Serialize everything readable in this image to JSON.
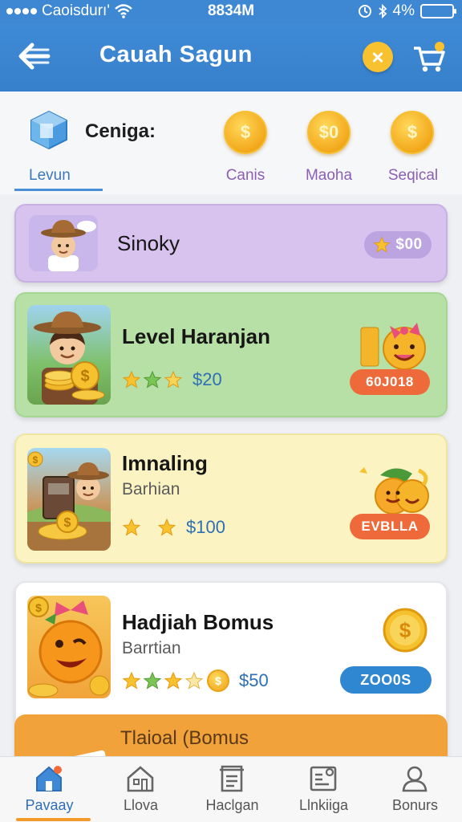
{
  "status_bar": {
    "carrier": "Caoisdurı'",
    "time": "8834M",
    "battery": "4%"
  },
  "app_bar": {
    "title": "Cauah Sagun"
  },
  "tabs": [
    {
      "label": "Levun",
      "heading": "Ceniga:",
      "icon": "cube-icon"
    },
    {
      "label": "Canis",
      "coin_glyph": "$",
      "icon": "coin-icon"
    },
    {
      "label": "Maoha",
      "coin_glyph": "$0",
      "icon": "coin-icon"
    },
    {
      "label": "Seqical",
      "coin_glyph": "$",
      "icon": "coin-icon"
    }
  ],
  "cards": [
    {
      "title": "Sinoky",
      "badge": "$00",
      "accent": "#d7c3ee"
    },
    {
      "title": "Level Haranjan",
      "price": "$20",
      "stars_filled": 3,
      "stars_total": 3,
      "action": "60J018",
      "accent": "#b7e0a6"
    },
    {
      "title": "Imnaling",
      "subtitle": "Barhian",
      "price": "$100",
      "stars_filled": 2,
      "stars_total": 2,
      "action": "EVBLLA",
      "accent": "#fbf4c2"
    },
    {
      "title": "Hadjiah Bomus",
      "subtitle": "Barrtian",
      "price": "$50",
      "stars_filled": 3,
      "stars_total": 4,
      "action": "ZOO0S",
      "accent": "#ffffff"
    },
    {
      "title": "Tlaioal (Bomus",
      "accent": "#f2a23a"
    }
  ],
  "bottom_nav": [
    {
      "label": "Pavaay",
      "icon": "home-icon",
      "active": true
    },
    {
      "label": "Llova",
      "icon": "house-icon",
      "active": false
    },
    {
      "label": "Haclgan",
      "icon": "list-icon",
      "active": false
    },
    {
      "label": "Llnkiiga",
      "icon": "gallery-icon",
      "active": false
    },
    {
      "label": "Bonurs",
      "icon": "user-icon",
      "active": false
    }
  ]
}
